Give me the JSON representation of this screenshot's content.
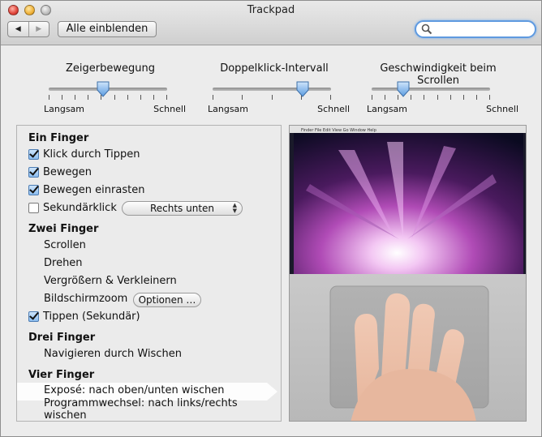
{
  "window": {
    "title": "Trackpad"
  },
  "toolbar": {
    "back_glyph": "◀",
    "forward_glyph": "▶",
    "show_all_label": "Alle einblenden",
    "search_value": ""
  },
  "sliders": [
    {
      "label": "Zeigerbewegung",
      "min_label": "Langsam",
      "max_label": "Schnell",
      "ticks": 10,
      "value": 0.46
    },
    {
      "label": "Doppelklick-Intervall",
      "min_label": "Langsam",
      "max_label": "Schnell",
      "ticks": 5,
      "value": 0.76
    },
    {
      "label": "Geschwindigkeit beim Scrollen",
      "min_label": "Langsam",
      "max_label": "Schnell",
      "ticks": 10,
      "value": 0.27
    }
  ],
  "gestures": {
    "one_finger": {
      "title": "Ein Finger",
      "tap_to_click": "Klick durch Tippen",
      "dragging": "Bewegen",
      "drag_lock": "Bewegen einrasten",
      "secondary_click": "Sekundärklick",
      "secondary_click_option": "Rechts unten"
    },
    "two_fingers": {
      "title": "Zwei Finger",
      "scroll": "Scrollen",
      "rotate": "Drehen",
      "zoom": "Vergrößern & Verkleinern",
      "screen_zoom": "Bildschirmzoom",
      "options_button": "Optionen …",
      "tap_secondary": "Tippen (Sekundär)"
    },
    "three_fingers": {
      "title": "Drei Finger",
      "swipe_navigate": "Navigieren durch Wischen"
    },
    "four_fingers": {
      "title": "Vier Finger",
      "expose": "Exposé: nach oben/unten wischen",
      "app_switch": "Programmwechsel: nach links/rechts wischen"
    }
  },
  "preview_menubar": "Finder  File  Edit  View  Go  Window  Help"
}
